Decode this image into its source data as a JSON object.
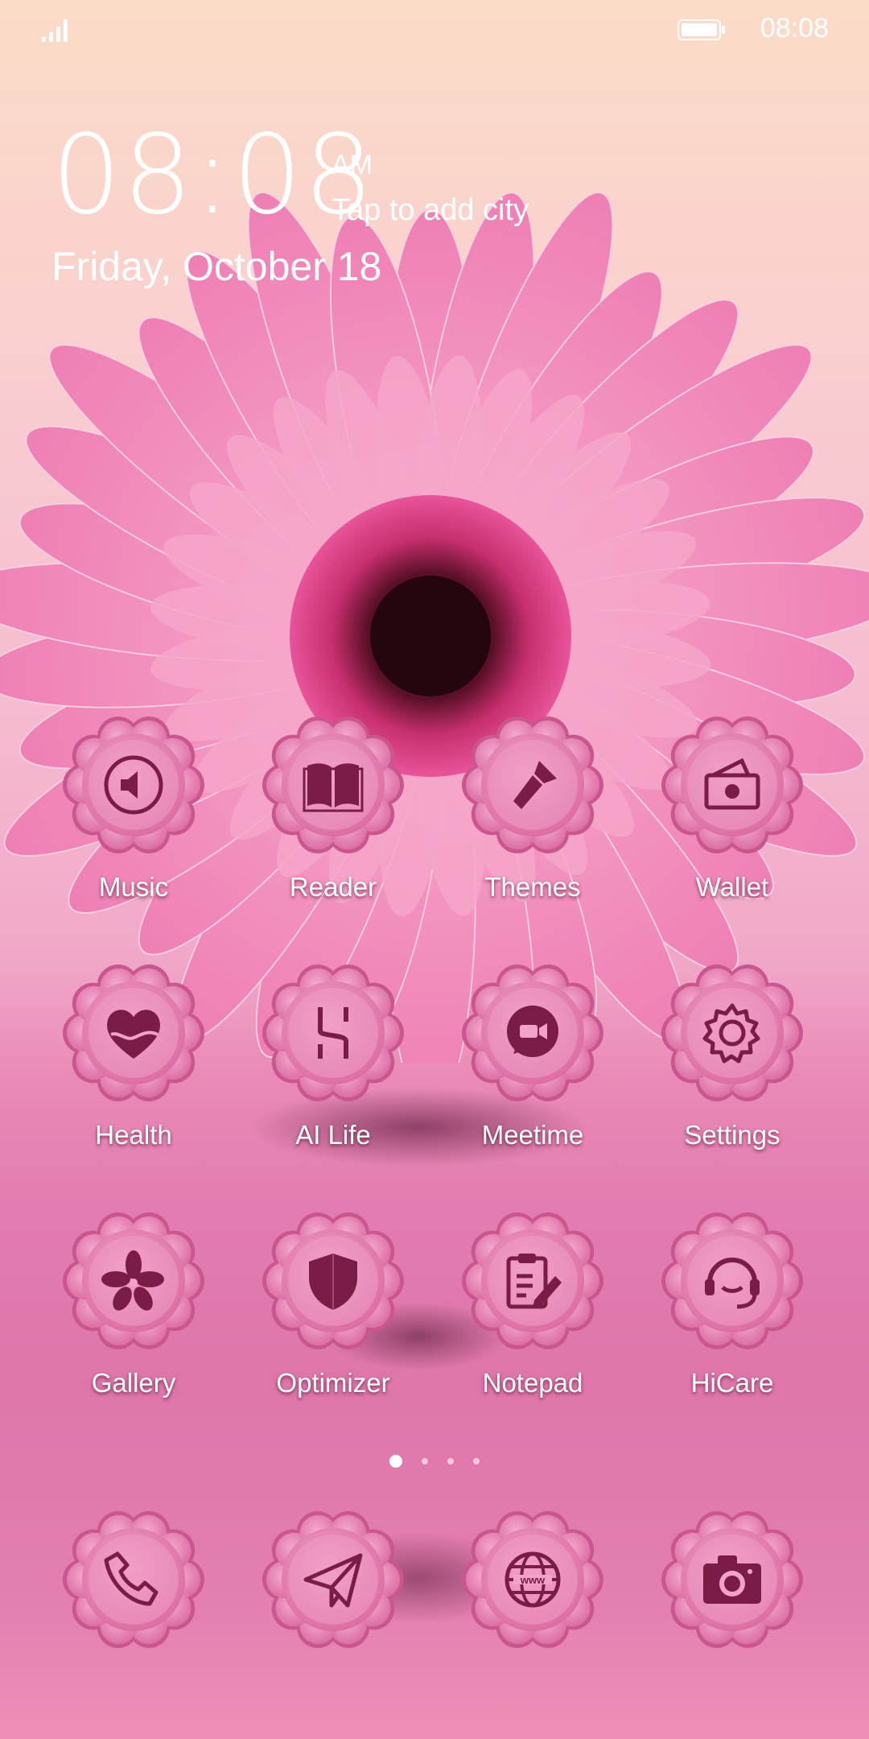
{
  "status_bar": {
    "time": "08:08",
    "signal_icon": "signal-icon",
    "battery_icon": "battery-icon"
  },
  "clock_widget": {
    "time": "08:08",
    "ampm": "AM",
    "city_prompt": "Tap to add city",
    "date": "Friday, October 18"
  },
  "apps": [
    {
      "label": "Music",
      "icon": "speaker-icon"
    },
    {
      "label": "Reader",
      "icon": "book-icon"
    },
    {
      "label": "Themes",
      "icon": "brush-icon"
    },
    {
      "label": "Wallet",
      "icon": "wallet-icon"
    },
    {
      "label": "Health",
      "icon": "heart-icon"
    },
    {
      "label": "AI Life",
      "icon": "ai-life-icon"
    },
    {
      "label": "Meetime",
      "icon": "video-chat-icon"
    },
    {
      "label": "Settings",
      "icon": "gear-icon"
    },
    {
      "label": "Gallery",
      "icon": "flower-icon"
    },
    {
      "label": "Optimizer",
      "icon": "shield-icon"
    },
    {
      "label": "Notepad",
      "icon": "notepad-icon"
    },
    {
      "label": "HiCare",
      "icon": "headset-icon"
    }
  ],
  "page_indicator": {
    "pages": 4,
    "active": 1
  },
  "dock": [
    {
      "icon": "phone-icon"
    },
    {
      "icon": "send-icon"
    },
    {
      "icon": "browser-icon"
    },
    {
      "icon": "camera-icon"
    }
  ],
  "colors": {
    "icon_bg": "#e98cbc",
    "glyph": "#7a1c46"
  }
}
